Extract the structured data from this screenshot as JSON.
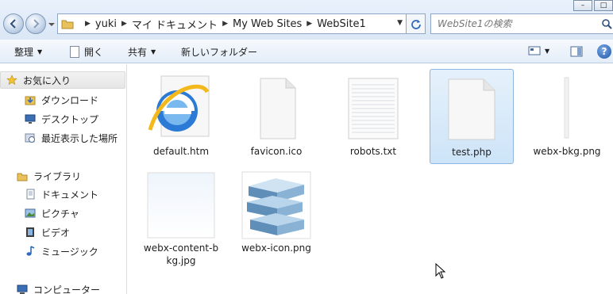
{
  "address": {
    "crumbs": [
      "yuki",
      "マイ ドキュメント",
      "My Web Sites",
      "WebSite1"
    ],
    "search_placeholder": "WebSite1の検索"
  },
  "toolbar": {
    "organize": "整理",
    "open": "開く",
    "share": "共有",
    "new_folder": "新しいフォルダー"
  },
  "sidebar": {
    "favorites": "お気に入り",
    "downloads": "ダウンロード",
    "desktop": "デスクトップ",
    "recent": "最近表示した場所",
    "libraries": "ライブラリ",
    "documents": "ドキュメント",
    "pictures": "ピクチャ",
    "videos": "ビデオ",
    "music": "ミュージック",
    "computer": "コンピューター"
  },
  "files": [
    {
      "name": "default.htm",
      "icon": "ie-icon"
    },
    {
      "name": "favicon.ico",
      "icon": "blank-file-icon"
    },
    {
      "name": "robots.txt",
      "icon": "text-file-icon"
    },
    {
      "name": "test.php",
      "icon": "blank-file-icon",
      "selected": true
    },
    {
      "name": "webx-bkg.png",
      "icon": "image-strip-icon"
    },
    {
      "name": "webx-content-bkg.jpg",
      "icon": "gradient-image-icon"
    },
    {
      "name": "webx-icon.png",
      "icon": "stacked-blocks-icon"
    }
  ],
  "colors": {
    "selection": "#cde4f8",
    "chrome": "#dbe7f6"
  }
}
